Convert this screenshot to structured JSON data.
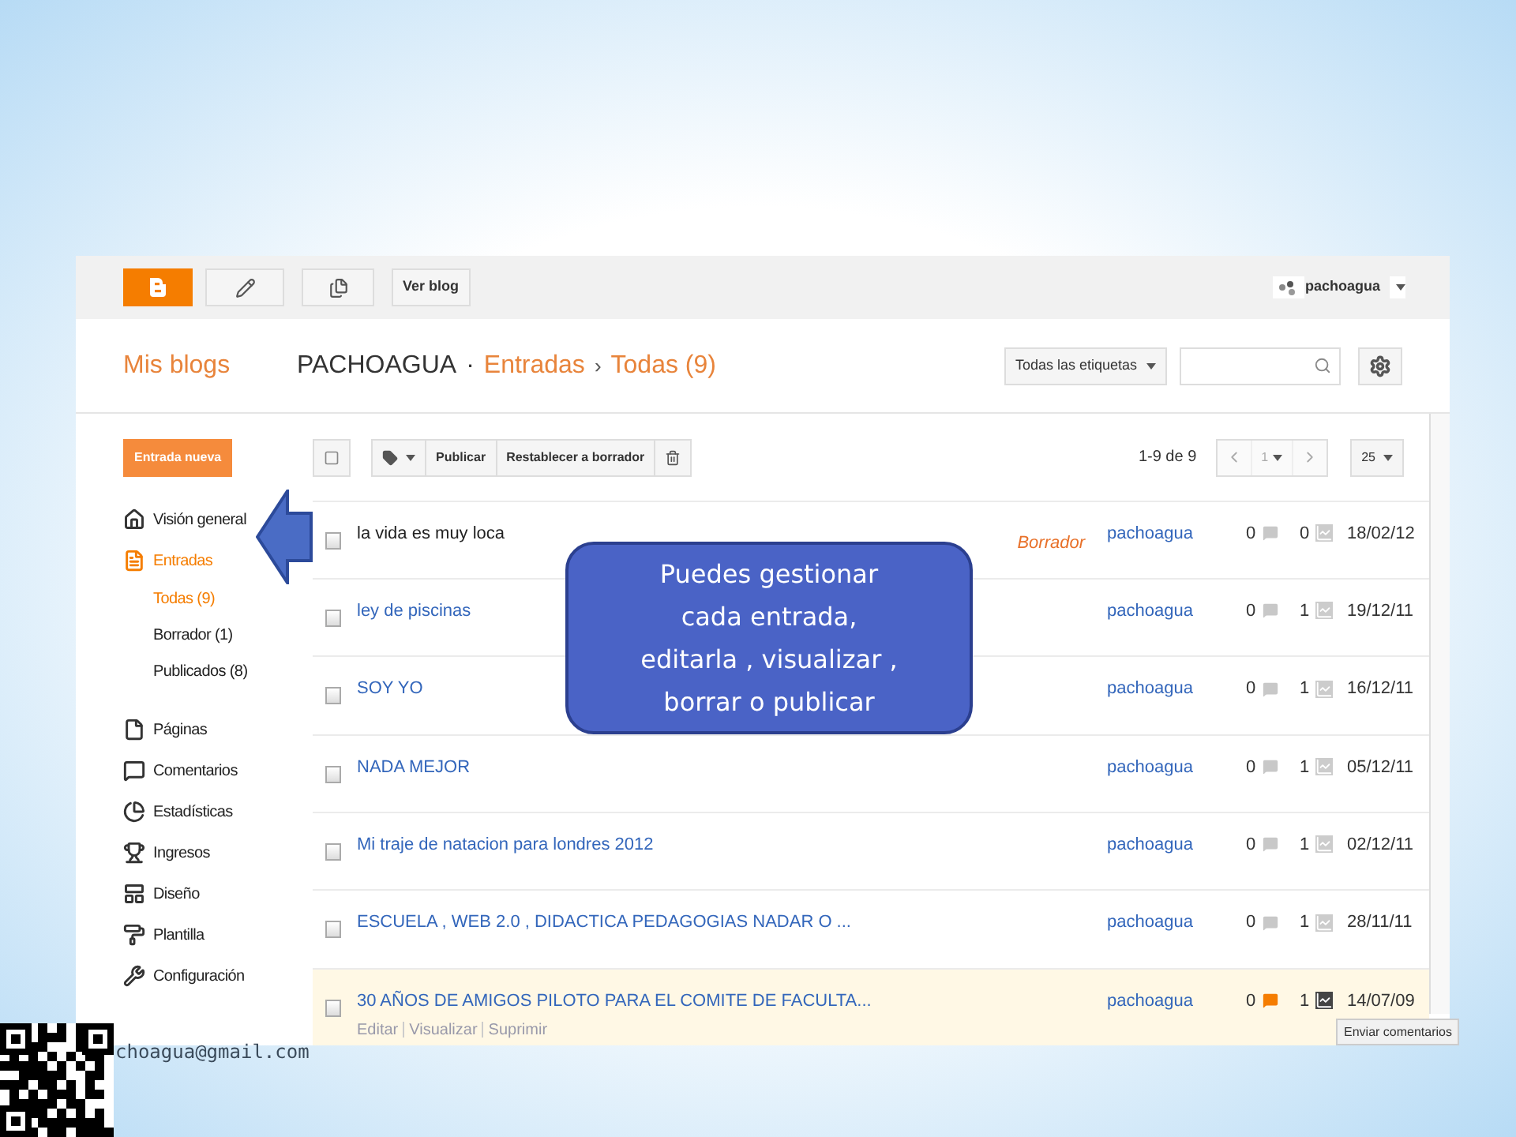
{
  "topbar": {
    "view_blog": "Ver blog",
    "user": "pachoagua"
  },
  "header": {
    "my_blogs": "Mis blogs",
    "blog": "PACHOAGUA",
    "separator": "·",
    "section": "Entradas",
    "chevron": "›",
    "current": "Todas (9)",
    "labels_filter": "Todas las etiquetas"
  },
  "sidebar": {
    "new_post": "Entrada nueva",
    "items": [
      {
        "label": "Visión general",
        "selected": false
      },
      {
        "label": "Entradas",
        "selected": true,
        "children": [
          {
            "label": "Todas (9)",
            "selected": true
          },
          {
            "label": "Borrador (1)",
            "selected": false
          },
          {
            "label": "Publicados (8)",
            "selected": false
          }
        ]
      },
      {
        "label": "Páginas",
        "selected": false
      },
      {
        "label": "Comentarios",
        "selected": false
      },
      {
        "label": "Estadísticas",
        "selected": false
      },
      {
        "label": "Ingresos",
        "selected": false
      },
      {
        "label": "Diseño",
        "selected": false
      },
      {
        "label": "Plantilla",
        "selected": false
      },
      {
        "label": "Configuración",
        "selected": false
      }
    ]
  },
  "toolbar": {
    "publish": "Publicar",
    "revert": "Restablecer a borrador",
    "range": "1-9 de 9",
    "page": "1",
    "per_page": "25"
  },
  "posts": [
    {
      "title": "la vida es muy loca",
      "status": "Borrador",
      "author": "pachoagua",
      "comments": "0",
      "views": "0",
      "date": "18/02/12",
      "highlighted": false
    },
    {
      "title": "ley de piscinas",
      "author": "pachoagua",
      "comments": "0",
      "views": "1",
      "date": "19/12/11",
      "highlighted": false
    },
    {
      "title": "SOY YO",
      "author": "pachoagua",
      "comments": "0",
      "views": "1",
      "date": "16/12/11",
      "highlighted": false
    },
    {
      "title": "NADA MEJOR",
      "author": "pachoagua",
      "comments": "0",
      "views": "1",
      "date": "05/12/11",
      "highlighted": false
    },
    {
      "title": "Mi traje de natacion para londres 2012",
      "author": "pachoagua",
      "comments": "0",
      "views": "1",
      "date": "02/12/11",
      "highlighted": false
    },
    {
      "title": "ESCUELA , WEB 2.0 , DIDACTICA PEDAGOGIAS NADAR O ...",
      "author": "pachoagua",
      "comments": "0",
      "views": "1",
      "date": "28/11/11",
      "highlighted": false
    },
    {
      "title": "30 AÑOS DE AMIGOS PILOTO PARA EL COMITE DE FACULTA...",
      "author": "pachoagua",
      "comments": "0",
      "views": "1",
      "date": "14/07/09",
      "highlighted": true,
      "actions": [
        "Editar",
        "Visualizar",
        "Suprimir"
      ]
    }
  ],
  "feedback": "Enviar comentarios",
  "callout": "Puedes gestionar\ncada entrada,\neditarla , visualizar ,\nborrar  o publicar",
  "email": "choagua@gmail.com"
}
